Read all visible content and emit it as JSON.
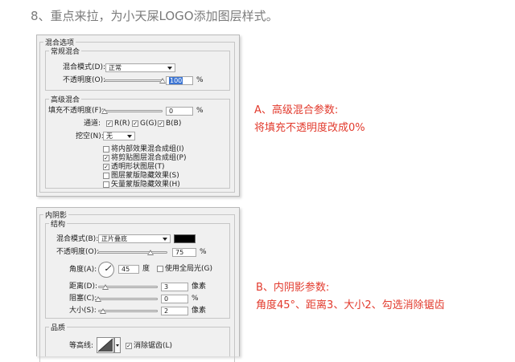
{
  "heading": "8、重点来拉，为小天屎LOGO添加图层样式。",
  "blend_dialog": {
    "title": "混合选项",
    "general": {
      "title": "常规混合",
      "mode_label": "混合模式(D):",
      "mode_value": "正常",
      "opacity_label": "不透明度(O):",
      "opacity_value": "100",
      "opacity_unit": "%",
      "opacity_fraction": 1.0
    },
    "advanced": {
      "title": "高级混合",
      "fill_label": "填充不透明度(F):",
      "fill_value": "0",
      "fill_unit": "%",
      "fill_fraction": 0.0,
      "channels_label": "通道:",
      "channels": [
        {
          "label": "R(R)",
          "checked": true
        },
        {
          "label": "G(G)",
          "checked": true
        },
        {
          "label": "B(B)",
          "checked": true
        }
      ],
      "knockout_label": "挖空(N):",
      "knockout_value": "无",
      "options": [
        {
          "label": "将内部效果混合成组(I)",
          "checked": false
        },
        {
          "label": "将剪贴图层混合成组(P)",
          "checked": true
        },
        {
          "label": "透明形状图层(T)",
          "checked": true
        },
        {
          "label": "图层蒙版隐藏效果(S)",
          "checked": false
        },
        {
          "label": "矢量蒙版隐藏效果(H)",
          "checked": false
        }
      ]
    }
  },
  "inner_shadow_dialog": {
    "title": "内阴影",
    "structure": {
      "title": "结构",
      "mode_label": "混合模式(B):",
      "mode_value": "正片叠底",
      "color": "#000000",
      "opacity_label": "不透明度(O):",
      "opacity_value": "75",
      "opacity_unit": "%",
      "opacity_fraction": 0.75,
      "angle_label": "角度(A):",
      "angle_value": "45",
      "angle_unit": "度",
      "global_light_label": "使用全局光(G)",
      "global_light_checked": false,
      "distance_label": "距离(D):",
      "distance_value": "3",
      "distance_unit": "像素",
      "distance_fraction": 0.12,
      "choke_label": "阻塞(C):",
      "choke_value": "0",
      "choke_unit": "%",
      "choke_fraction": 0.0,
      "size_label": "大小(S):",
      "size_value": "2",
      "size_unit": "像素",
      "size_fraction": 0.08
    },
    "quality": {
      "title": "品质",
      "contour_label": "等高线:",
      "antialias_label": "消除锯齿(L)",
      "antialias_checked": true
    }
  },
  "annotations": {
    "a_title": "A、高级混合参数:",
    "a_detail": "将填充不透明度改成0%",
    "b_title": "B、内阴影参数:",
    "b_detail": "角度45°、距离3、大小2、勾选消除锯齿"
  },
  "colors": {
    "annotation": "#e23a2d",
    "selection": "#3b74d3"
  }
}
